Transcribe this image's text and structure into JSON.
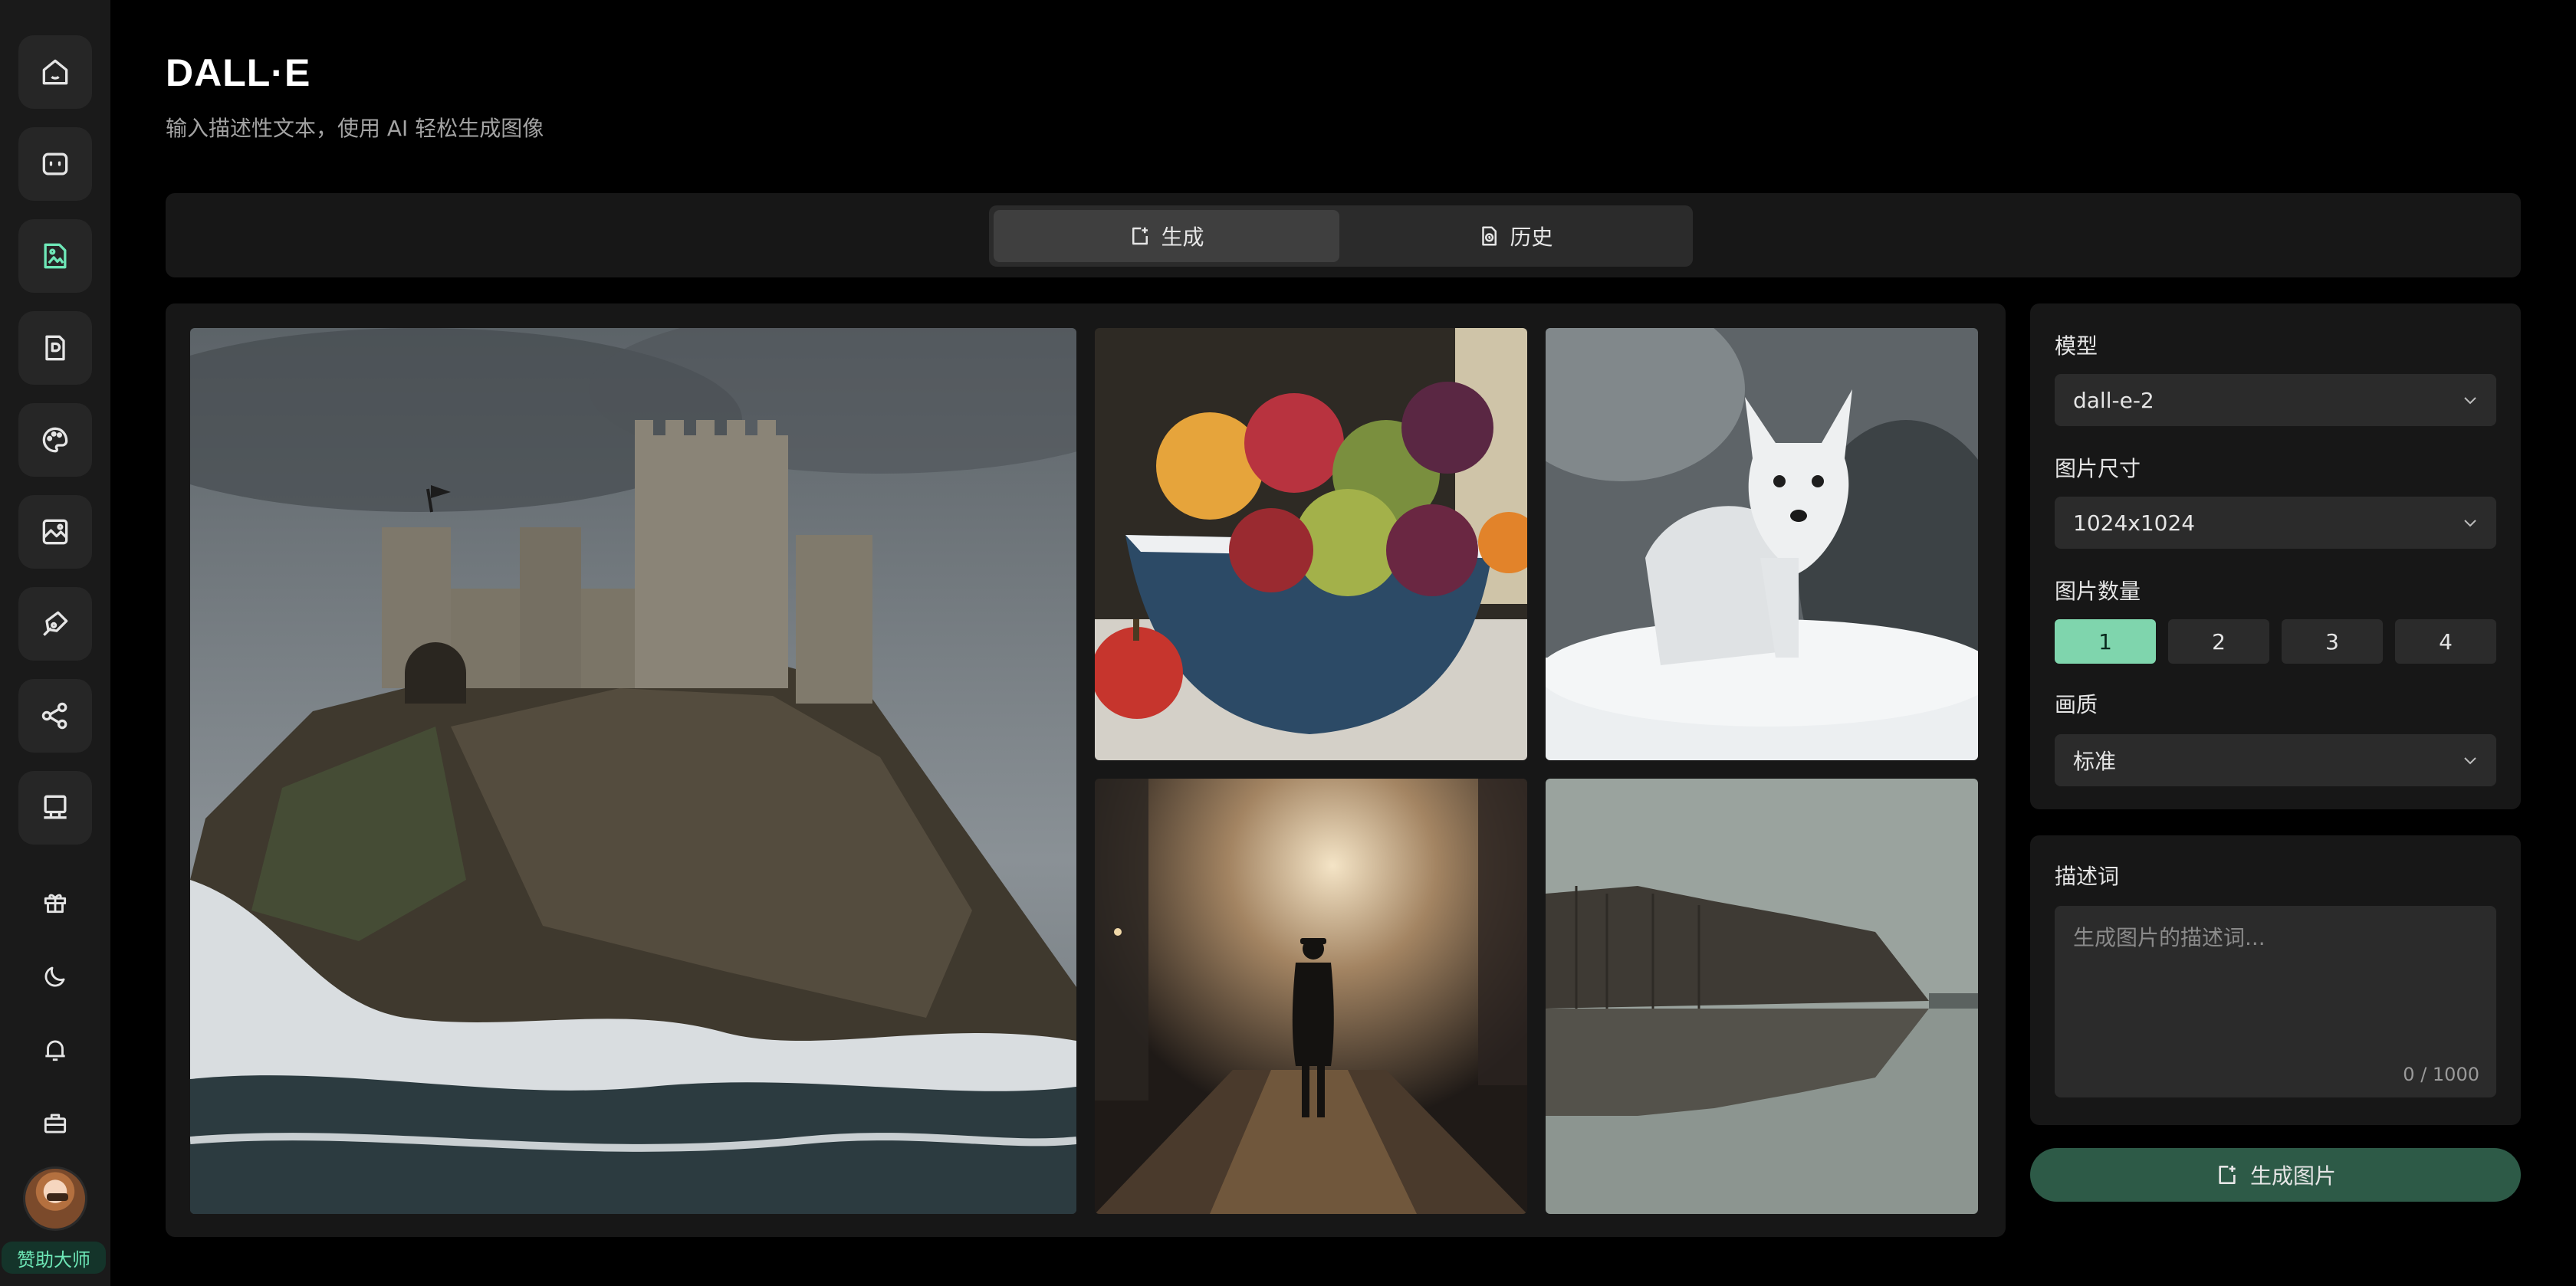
{
  "app": {
    "title": "DALL·E",
    "subtitle": "输入描述性文本，使用 AI 轻松生成图像"
  },
  "sidebar": {
    "items": [
      {
        "icon": "home-icon"
      },
      {
        "icon": "chat-icon"
      },
      {
        "icon": "image-generate-icon",
        "active": true
      },
      {
        "icon": "document-icon"
      },
      {
        "icon": "palette-icon"
      },
      {
        "icon": "picture-icon"
      },
      {
        "icon": "pen-icon"
      },
      {
        "icon": "share-icon"
      },
      {
        "icon": "presentation-icon"
      }
    ],
    "utilities": [
      {
        "icon": "gift-icon"
      },
      {
        "icon": "moon-icon"
      },
      {
        "icon": "bell-icon"
      },
      {
        "icon": "briefcase-icon"
      }
    ],
    "sponsor_label": "赞助大师"
  },
  "tabs": [
    {
      "label": "生成",
      "icon": "edit-icon",
      "active": true
    },
    {
      "label": "历史",
      "icon": "history-icon",
      "active": false
    }
  ],
  "gallery": [
    {
      "name": "castle-image"
    },
    {
      "name": "fruit-bowl-image"
    },
    {
      "name": "arctic-fox-image"
    },
    {
      "name": "street-figure-image"
    },
    {
      "name": "lake-reflection-image"
    }
  ],
  "settings": {
    "model_label": "模型",
    "model_value": "dall-e-2",
    "size_label": "图片尺寸",
    "size_value": "1024x1024",
    "count_label": "图片数量",
    "count_options": [
      "1",
      "2",
      "3",
      "4"
    ],
    "count_selected": "1",
    "quality_label": "画质",
    "quality_value": "标准"
  },
  "prompt": {
    "label": "描述词",
    "placeholder": "生成图片的描述词...",
    "counter": "0 / 1000"
  },
  "generate_button": {
    "label": "生成图片"
  },
  "colors": {
    "accent": "#7fd5ad",
    "button_bg": "#2d5a47",
    "panel_bg": "#171717",
    "sidebar_bg": "#1a1a1a"
  }
}
